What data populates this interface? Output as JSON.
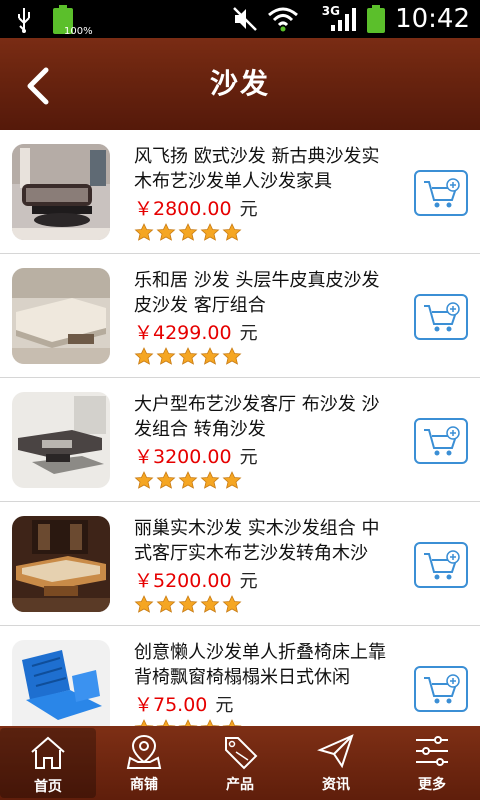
{
  "statusbar": {
    "time": "10:42",
    "battery_pct": "100%",
    "network": "3G"
  },
  "header": {
    "title": "沙发"
  },
  "products": [
    {
      "name": "风飞扬 欧式沙发 新古典沙发实木布艺沙发单人沙发家具",
      "price": "￥2800.00",
      "unit": "元",
      "rating": 5
    },
    {
      "name": "乐和居 沙发 头层牛皮真皮沙发皮沙发 客厅组合",
      "price": "￥4299.00",
      "unit": "元",
      "rating": 5
    },
    {
      "name": "大户型布艺沙发客厅 布沙发 沙发组合 转角沙发",
      "price": "￥3200.00",
      "unit": "元",
      "rating": 5
    },
    {
      "name": "丽巢实木沙发 实木沙发组合 中式客厅实木布艺沙发转角木沙",
      "price": "￥5200.00",
      "unit": "元",
      "rating": 5
    },
    {
      "name": "创意懒人沙发单人折叠椅床上靠背椅飘窗椅榻榻米日式休闲",
      "price": "￥75.00",
      "unit": "元",
      "rating": 5
    }
  ],
  "nav": {
    "home": "首页",
    "shops": "商铺",
    "products": "产品",
    "news": "资讯",
    "more": "更多"
  },
  "colors": {
    "header": "#6a240f",
    "price": "#e60000",
    "cart_border": "#3b8fd5",
    "star": "#f5a623"
  }
}
